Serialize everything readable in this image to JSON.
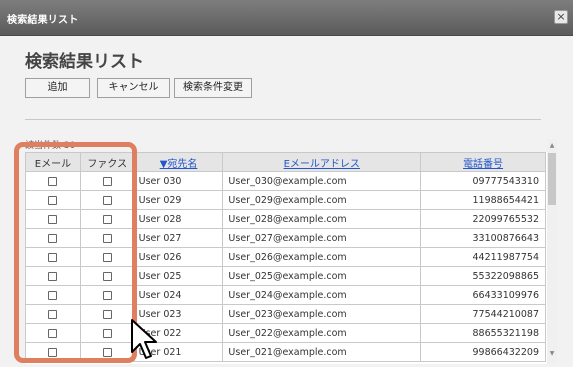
{
  "window": {
    "title": "検索結果リスト",
    "close_glyph": "×"
  },
  "page": {
    "heading": "検索結果リスト"
  },
  "buttons": {
    "add": "追加",
    "cancel": "キャンセル",
    "change_conditions": "検索条件変更"
  },
  "results": {
    "count_text": "該当件数 30"
  },
  "table": {
    "columns": {
      "email_check": "Eメール",
      "fax_check": "ファクス",
      "name": "▼宛先名",
      "email": "Eメールアドレス",
      "phone": "電話番号"
    },
    "rows": [
      {
        "name": "User 030",
        "email": "User_030@example.com",
        "phone": "09777543310"
      },
      {
        "name": "User 029",
        "email": "User_029@example.com",
        "phone": "11988654421"
      },
      {
        "name": "User 028",
        "email": "User_028@example.com",
        "phone": "22099765532"
      },
      {
        "name": "User 027",
        "email": "User_027@example.com",
        "phone": "33100876643"
      },
      {
        "name": "User 026",
        "email": "User_026@example.com",
        "phone": "44211987754"
      },
      {
        "name": "User 025",
        "email": "User_025@example.com",
        "phone": "55322098865"
      },
      {
        "name": "User 024",
        "email": "User_024@example.com",
        "phone": "66433109976"
      },
      {
        "name": "User 023",
        "email": "User_023@example.com",
        "phone": "77544210087"
      },
      {
        "name": "User 022",
        "email": "User_022@example.com",
        "phone": "88655321198"
      },
      {
        "name": "User 021",
        "email": "User_021@example.com",
        "phone": "99866432209"
      }
    ]
  },
  "scrollbar": {
    "up_glyph": "▲",
    "down_glyph": "▼"
  },
  "colors": {
    "highlight": "#e07e60",
    "link": "#2255cc",
    "titlebar": "#6a6a6a"
  }
}
